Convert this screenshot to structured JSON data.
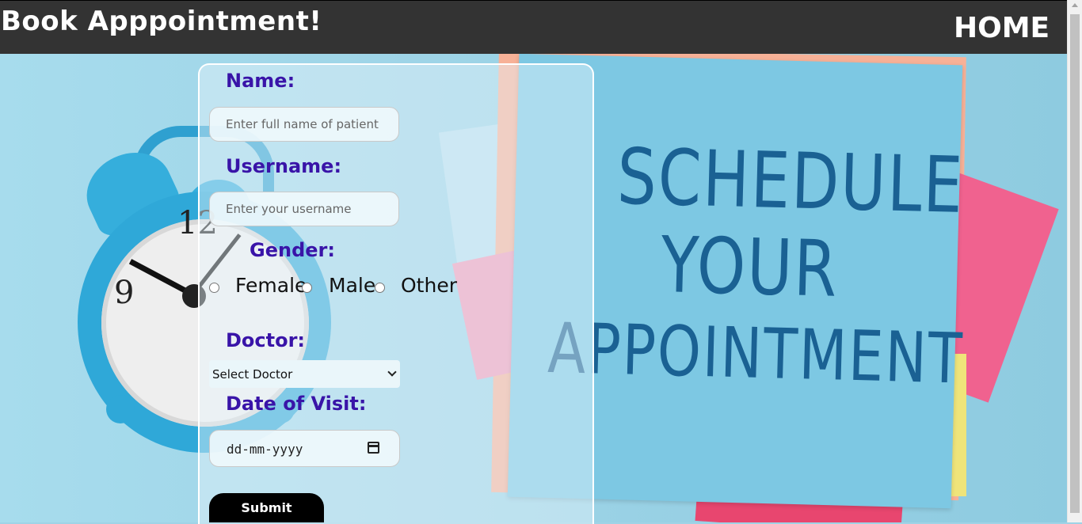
{
  "header": {
    "title": "Book Apppointment!",
    "home_link": "HOME"
  },
  "background": {
    "note_lines": [
      "SCHEDULE",
      "YOUR",
      "APPOINTMENT"
    ],
    "clock_numbers": [
      "12",
      "9"
    ]
  },
  "form": {
    "name_label": "Name:",
    "name_placeholder": "Enter full name of patient",
    "username_label": "Username:",
    "username_placeholder": "Enter your username",
    "gender_label": "Gender:",
    "gender_options": [
      "Female",
      "Male",
      "Other"
    ],
    "doctor_label": "Doctor:",
    "doctor_selected": "Select Doctor",
    "date_label": "Date of Visit:",
    "date_placeholder": "dd-mm-yyyy",
    "submit_label": "Submit"
  },
  "colors": {
    "header_bg": "#333333",
    "label_color": "#3914a8",
    "submit_bg": "#000000"
  },
  "icons": [
    "calendar-icon",
    "chevron-down-icon"
  ]
}
